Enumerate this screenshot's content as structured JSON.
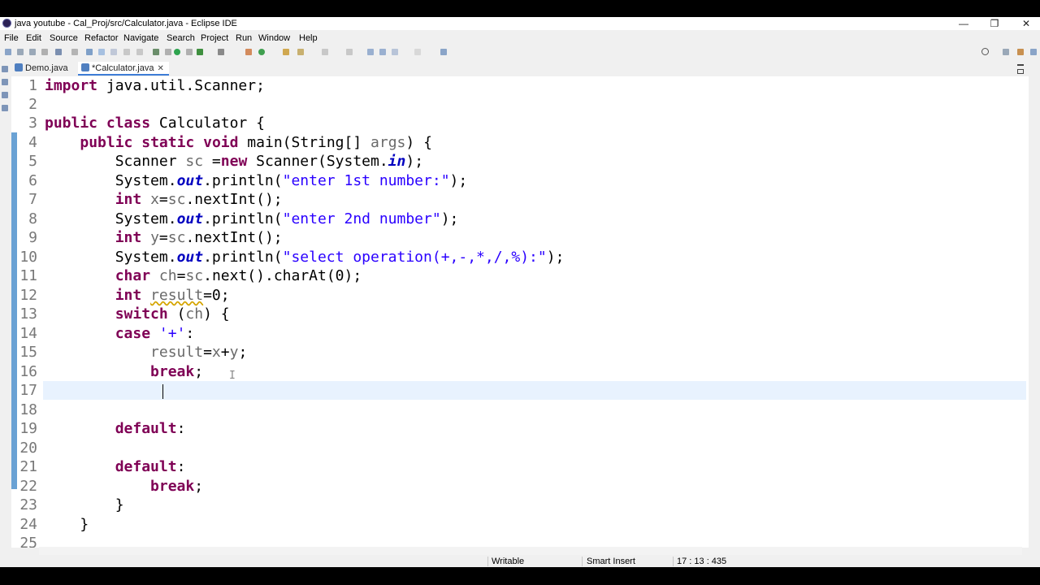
{
  "window": {
    "title": "java youtube - Cal_Proj/src/Calculator.java - Eclipse IDE"
  },
  "menus": [
    "File",
    "Edit",
    "Source",
    "Refactor",
    "Navigate",
    "Search",
    "Project",
    "Run",
    "Window",
    "Help"
  ],
  "tabs": [
    {
      "label": "Demo.java"
    },
    {
      "label": "*Calculator.java"
    }
  ],
  "line_numbers": [
    "1",
    "2",
    "3",
    "4",
    "5",
    "6",
    "7",
    "8",
    "9",
    "10",
    "11",
    "12",
    "13",
    "14",
    "15",
    "16",
    "17",
    "18",
    "19",
    "20",
    "21",
    "22",
    "23",
    "24",
    "25"
  ],
  "status": {
    "writable": "Writable",
    "insert_mode": "Smart Insert",
    "position": "17 : 13 : 435"
  },
  "colors": {
    "keyword": "#7f0055",
    "string": "#2a00ff",
    "field": "#0000c0",
    "current_line": "#e8f2fe",
    "active_tab_underline": "#3d7cd6"
  }
}
